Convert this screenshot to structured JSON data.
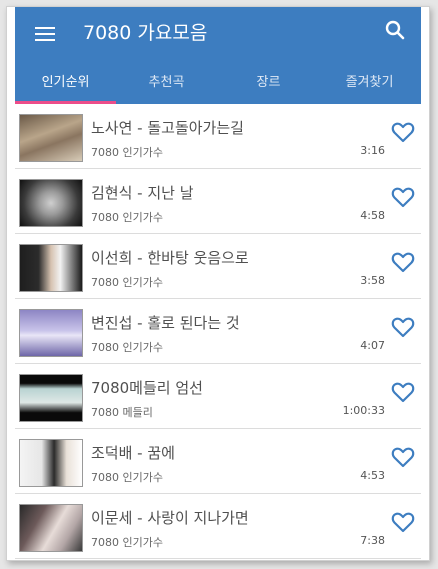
{
  "app": {
    "title": "7080 가요모음",
    "primary_color": "#3d7dc0",
    "accent_color": "#ec4d8a"
  },
  "tabs": [
    {
      "label": "인기순위",
      "active": true
    },
    {
      "label": "추천곡",
      "active": false
    },
    {
      "label": "장르",
      "active": false
    },
    {
      "label": "즐겨찾기",
      "active": false
    }
  ],
  "songs": [
    {
      "title": "노사연 - 돌고돌아가는길",
      "category": "7080 인기가수",
      "duration": "3:16",
      "favorited": false
    },
    {
      "title": "김현식 - 지난 날",
      "category": "7080 인기가수",
      "duration": "4:58",
      "favorited": false
    },
    {
      "title": "이선희 - 한바탕 웃음으로",
      "category": "7080 인기가수",
      "duration": "3:58",
      "favorited": false
    },
    {
      "title": "변진섭 - 홀로 된다는 것",
      "category": "7080 인기가수",
      "duration": "4:07",
      "favorited": false
    },
    {
      "title": "7080메들리 엄선",
      "category": "7080 메들리",
      "duration": "1:00:33",
      "favorited": false
    },
    {
      "title": "조덕배 - 꿈에",
      "category": "7080 인기가수",
      "duration": "4:53",
      "favorited": false
    },
    {
      "title": "이문세 - 사랑이 지나가면",
      "category": "7080 인기가수",
      "duration": "7:38",
      "favorited": false
    }
  ],
  "icons": {
    "menu": "menu-icon",
    "search": "search-icon",
    "favorite": "heart-outline-icon"
  }
}
